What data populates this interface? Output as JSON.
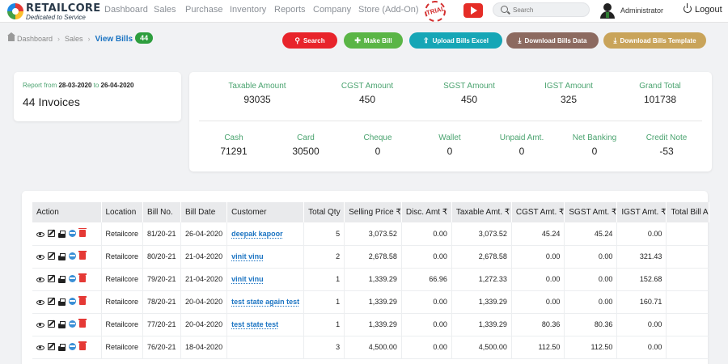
{
  "header": {
    "logo_name": "RETAILCORE",
    "logo_tagline": "Dedicated to Service",
    "nav": [
      "Dashboard",
      "Sales",
      "Purchase",
      "Inventory",
      "Reports",
      "Company",
      "Store (Add-On)"
    ],
    "trial_badge": "TRIAL",
    "search_placeholder": "Search",
    "user": "Administrator",
    "logout": "Logout"
  },
  "breadcrumb": {
    "home": "Dashboard",
    "section": "Sales",
    "current": "View Bills",
    "count": "44"
  },
  "actions": [
    {
      "label": "Search",
      "icon": "search-icon",
      "color": "#e8242b"
    },
    {
      "label": "Make Bill",
      "icon": "plus-icon",
      "color": "#5ab546"
    },
    {
      "label": "Upload Bills Excel",
      "icon": "upload-icon",
      "color": "#16a6b6"
    },
    {
      "label": "Download Bills Data",
      "icon": "download-icon",
      "color": "#8c6a60"
    },
    {
      "label": "Download Bills Template",
      "icon": "download-icon",
      "color": "#c9a45a"
    }
  ],
  "report": {
    "prefix": "Report from",
    "from": "28-03-2020",
    "to_word": "to",
    "to": "26-04-2020",
    "invoices": "44 Invoices"
  },
  "summary_top": [
    {
      "label": "Taxable Amount",
      "value": "93035"
    },
    {
      "label": "CGST Amount",
      "value": "450"
    },
    {
      "label": "SGST Amount",
      "value": "450"
    },
    {
      "label": "IGST Amount",
      "value": "325"
    },
    {
      "label": "Grand Total",
      "value": "101738"
    }
  ],
  "summary_bottom": [
    {
      "label": "Cash",
      "value": "71291"
    },
    {
      "label": "Card",
      "value": "30500"
    },
    {
      "label": "Cheque",
      "value": "0"
    },
    {
      "label": "Wallet",
      "value": "0"
    },
    {
      "label": "Unpaid Amt.",
      "value": "0"
    },
    {
      "label": "Net Banking",
      "value": "0"
    },
    {
      "label": "Credit Note",
      "value": "-53"
    }
  ],
  "table": {
    "headers": [
      "Action",
      "Location",
      "Bill No.",
      "Bill Date",
      "Customer",
      "Total Qty",
      "Selling Price ₹",
      "Disc. Amt ₹",
      "Taxable Amt. ₹",
      "CGST Amt. ₹",
      "SGST Amt. ₹",
      "IGST Amt. ₹",
      "Total Bill A"
    ],
    "rows": [
      [
        "Retailcore",
        "81/20-21",
        "26-04-2020",
        "deepak kapoor",
        "5",
        "3,073.52",
        "0.00",
        "3,073.52",
        "45.24",
        "45.24",
        "0.00"
      ],
      [
        "Retailcore",
        "80/20-21",
        "21-04-2020",
        "vinit vinu",
        "2",
        "2,678.58",
        "0.00",
        "2,678.58",
        "0.00",
        "0.00",
        "321.43"
      ],
      [
        "Retailcore",
        "79/20-21",
        "21-04-2020",
        "vinit vinu",
        "1",
        "1,339.29",
        "66.96",
        "1,272.33",
        "0.00",
        "0.00",
        "152.68"
      ],
      [
        "Retailcore",
        "78/20-21",
        "20-04-2020",
        "test state again test",
        "1",
        "1,339.29",
        "0.00",
        "1,339.29",
        "0.00",
        "0.00",
        "160.71"
      ],
      [
        "Retailcore",
        "77/20-21",
        "20-04-2020",
        "test state test",
        "1",
        "1,339.29",
        "0.00",
        "1,339.29",
        "80.36",
        "80.36",
        "0.00"
      ],
      [
        "Retailcore",
        "76/20-21",
        "18-04-2020",
        "",
        "3",
        "4,500.00",
        "0.00",
        "4,500.00",
        "112.50",
        "112.50",
        "0.00"
      ]
    ]
  }
}
